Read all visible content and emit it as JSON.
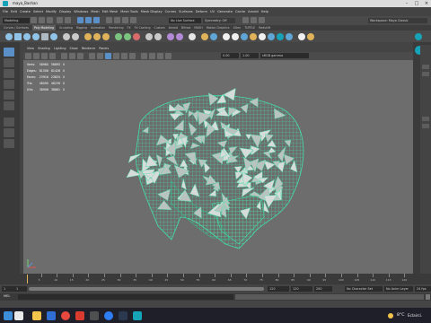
{
  "window": {
    "title": "maya_Bashan"
  },
  "menubar": {
    "items": [
      "File",
      "Edit",
      "Create",
      "Select",
      "Modify",
      "Display",
      "Windows",
      "Mesh",
      "Edit Mesh",
      "Mesh Tools",
      "Mesh Display",
      "Curves",
      "Surfaces",
      "Deform",
      "UV",
      "Generate",
      "Cache",
      "Arnold",
      "Help"
    ]
  },
  "statusline": {
    "mode": "Modeling",
    "live_surface": "No Live Surface",
    "symmetry": "Symmetry: Off",
    "workspace": "Workspace: Maya Classic"
  },
  "shelf": {
    "tabs": [
      "Curves / Surfaces",
      "Poly Modeling",
      "Sculpting",
      "Rigging",
      "Animation",
      "Rendering",
      "FX",
      "FX Caching",
      "Custom",
      "Arnold",
      "Bifrost",
      "MASH",
      "Motion Graphics",
      "XGen",
      "TURTLE",
      "Redshift"
    ],
    "active_tab": "Poly Modeling"
  },
  "viewport": {
    "menu": [
      "View",
      "Shading",
      "Lighting",
      "Show",
      "Renderer",
      "Panels"
    ],
    "camera_fields": [
      "0.00",
      "1.00"
    ],
    "color_space": "sRGB gamma"
  },
  "hud": {
    "rows": [
      {
        "label": "Verts:",
        "a": "58960",
        "b": "56893",
        "c": "0"
      },
      {
        "label": "Edges:",
        "a": "81506",
        "b": "81426",
        "c": "0"
      },
      {
        "label": "Faces:",
        "a": "23916",
        "b": "23834",
        "c": "0"
      },
      {
        "label": "Tris:",
        "a": "46090",
        "b": "46239",
        "c": "0"
      },
      {
        "label": "UVs:",
        "a": "38906",
        "b": "38861",
        "c": "0"
      }
    ]
  },
  "timeslider": {
    "ticks": [
      "5",
      "10",
      "15",
      "20",
      "25",
      "30",
      "35",
      "40",
      "45",
      "50",
      "55",
      "60",
      "65",
      "70",
      "75",
      "80",
      "85",
      "90",
      "95",
      "100",
      "105",
      "110",
      "115",
      "120"
    ],
    "current_frame": "1"
  },
  "rangeslider": {
    "start": "1",
    "range_start": "1",
    "range_end": "120",
    "end": "120",
    "end2": "200",
    "character_set": "No Character Set",
    "anim_layer": "No Anim Layer",
    "fps": "24 fps"
  },
  "cmdline": {
    "label": "MEL"
  },
  "taskbar": {
    "temperature": "8°C",
    "weather": "Eclairci."
  },
  "colors": {
    "mesh_wire": "#43e0a8",
    "mesh_shade": "#c9d3cf",
    "viewport_bg": "#6d6d6d",
    "accent": "#5a8fc7"
  }
}
